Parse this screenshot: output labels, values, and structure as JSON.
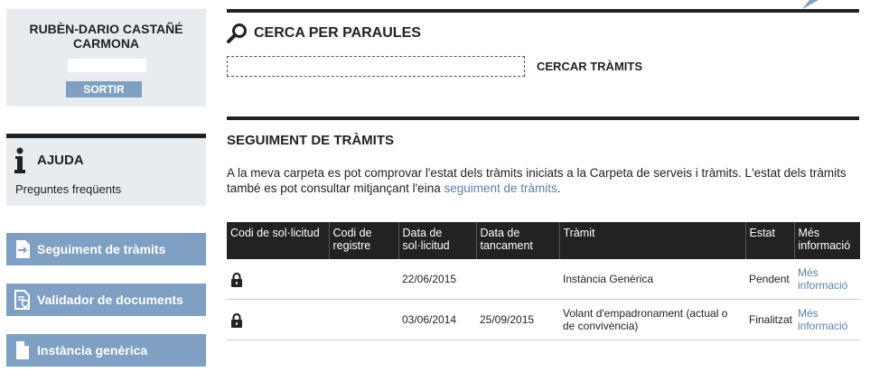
{
  "user": {
    "name": "RUBÈN-DARIO CASTAÑÉ CARMONA",
    "field_value": "",
    "logout_label": "SORTIR"
  },
  "help": {
    "icon": "info-icon",
    "title": "AJUDA",
    "link": "Preguntes freqüents"
  },
  "nav": {
    "items": [
      {
        "label": "Seguiment de tràmits",
        "icon": "arrow-in-icon"
      },
      {
        "label": "Validador de documents",
        "icon": "document-seal-icon"
      },
      {
        "label": "Instància genèrica",
        "icon": "document-icon"
      }
    ]
  },
  "search": {
    "title": "CERCA PER PARAULES",
    "input_value": "",
    "button_label": "CERCAR TRÀMITS"
  },
  "tracking": {
    "title": "SEGUIMENT DE TRÀMITS",
    "intro_text": "A la meva carpeta es pot comprovar l'estat dels tràmits iniciats a la Carpeta de serveis i tràmits. L'estat dels tràmits també es pot consultar mitjançant l'eina ",
    "intro_link": "seguiment de tràmits",
    "intro_end": ".",
    "columns": [
      "Codi de sol·licitud",
      "Codi de registre",
      "Data de sol·licitud",
      "Data de tancament",
      "Tràmit",
      "Estat",
      "Més informació"
    ],
    "rows": [
      {
        "request_code": "",
        "registry_code": "",
        "request_date": "22/06/2015",
        "close_date": "",
        "procedure": "Instància Genèrica",
        "status": "Pendent",
        "more": "Més informació"
      },
      {
        "request_code": "",
        "registry_code": "",
        "request_date": "03/06/2014",
        "close_date": "25/09/2015",
        "procedure": "Volant d'empadronament (actual o de convivència)",
        "status": "Finalitzat",
        "more": "Més informació"
      }
    ]
  },
  "colors": {
    "accent": "#7fa0c3",
    "panel": "#e8ecf1",
    "link": "#5a80b0",
    "rule": "#222222"
  }
}
